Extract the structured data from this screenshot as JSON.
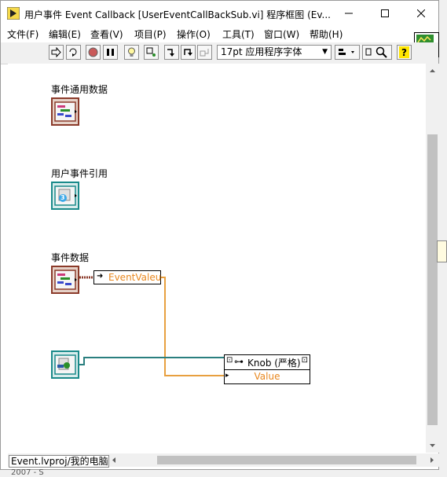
{
  "window": {
    "title": "用户事件 Event Callback [UserEventCallBackSub.vi] 程序框图 (Ev..."
  },
  "menu": [
    "文件(F)",
    "编辑(E)",
    "查看(V)",
    "项目(P)",
    "操作(O)",
    "工具(T)",
    "窗口(W)",
    "帮助(H)"
  ],
  "toolbar": {
    "font_label": "17pt 应用程序字体"
  },
  "diagram": {
    "labels": {
      "event_common_data": "事件通用数据",
      "user_event_ref": "用户事件引用",
      "event_data": "事件数据"
    },
    "ref_badge_number": "3",
    "unbundle": {
      "field": "EventValeu"
    },
    "property_node": {
      "class": "Knob (严格)",
      "property": "Value"
    },
    "colors": {
      "cluster": "#8b3a2a",
      "refnum": "#1a8a8a",
      "wire_orange": "#e8a040",
      "wire_teal": "#2a7f7f"
    }
  },
  "status_bar": {
    "path": "Event.lvproj/我的电脑",
    "footer": "2007 - S"
  },
  "icons": [
    "labview-app-icon",
    "minimize-icon",
    "maximize-icon",
    "close-icon",
    "run-arrow-icon",
    "run-continuous-icon",
    "abort-icon",
    "pause-icon",
    "highlight-bulb-icon",
    "retain-wire-icon",
    "step-into-icon",
    "step-over-icon",
    "step-out-icon",
    "align-icon",
    "search-icon",
    "help-icon"
  ]
}
